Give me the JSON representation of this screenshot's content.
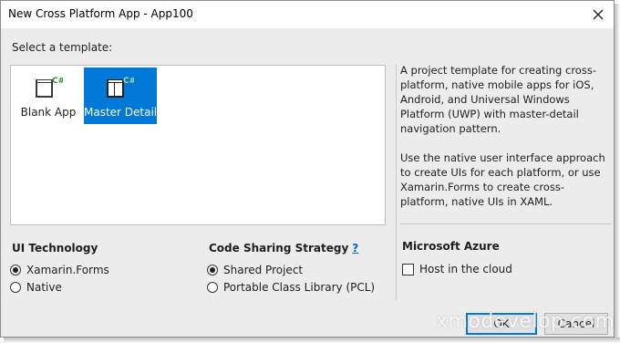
{
  "window": {
    "title": "New Cross Platform App - App100",
    "close_glyph": "✕"
  },
  "templates": {
    "heading": "Select a template:",
    "items": [
      {
        "label": "Blank App",
        "icon": "blank-app-icon",
        "selected": false
      },
      {
        "label": "Master Detail",
        "icon": "master-detail-icon",
        "selected": true
      }
    ]
  },
  "description": {
    "para1": "A project template for creating cross-platform, native mobile apps for iOS, Android, and Universal Windows Platform (UWP) with master-detail navigation pattern.",
    "para2": "Use the native user interface approach to create UIs for each platform, or use Xamarin.Forms to create cross-platform, native UIs in XAML."
  },
  "ui_technology": {
    "heading": "UI Technology",
    "options": [
      {
        "label": "Xamarin.Forms",
        "selected": true
      },
      {
        "label": "Native",
        "selected": false
      }
    ]
  },
  "code_sharing": {
    "heading": "Code Sharing Strategy",
    "help": "?",
    "options": [
      {
        "label": "Shared Project",
        "selected": true
      },
      {
        "label": "Portable Class Library (PCL)",
        "selected": false
      }
    ]
  },
  "azure": {
    "heading": "Microsoft Azure",
    "host_label": "Host in the cloud",
    "host_checked": false
  },
  "buttons": {
    "ok": "OK",
    "cancel": "Cancel"
  },
  "watermark": "xmodevelop.com",
  "colors": {
    "accent": "#0078d7",
    "dialog_bg": "#ececec",
    "link": "#0066cc"
  }
}
